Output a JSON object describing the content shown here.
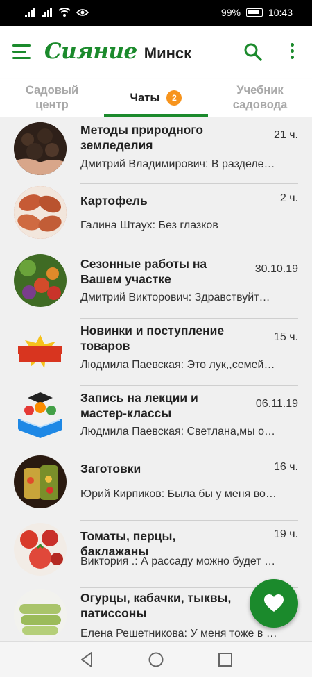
{
  "status_bar": {
    "battery": "99%",
    "time": "10:43"
  },
  "app_bar": {
    "brand": "Сияние",
    "city": "Минск"
  },
  "tabs": [
    {
      "label": "Садовый центр",
      "active": false
    },
    {
      "label": "Чаты",
      "active": true,
      "badge": "2"
    },
    {
      "label": "Учебник садовода",
      "active": false
    }
  ],
  "chats": [
    {
      "title": "Методы природного земледелия",
      "time": "21 ч.",
      "preview": "Дмитрий Владимирович: В разделе…",
      "avatar_icon": "soil-icon"
    },
    {
      "title": "Картофель",
      "time": "2 ч.",
      "preview": "Галина Штаух: Без глазков",
      "avatar_icon": "potato-icon"
    },
    {
      "title": "Сезонные работы на Вашем участке",
      "time": "30.10.19",
      "preview": "Дмитрий  Викторович: Здравствуйт…",
      "avatar_icon": "vegetables-icon"
    },
    {
      "title": "Новинки и поступление товаров",
      "time": "15 ч.",
      "preview": "Людмила Паевская: Это лук,,семей…",
      "avatar_icon": "new-items-icon"
    },
    {
      "title": "Запись на лекции и мастер-классы",
      "time": "06.11.19",
      "preview": "Людмила Паевская: Светлана,мы о…",
      "avatar_icon": "education-icon"
    },
    {
      "title": "Заготовки",
      "time": "16 ч.",
      "preview": "Юрий Кирпиков: Была бы у меня во…",
      "avatar_icon": "preserves-icon"
    },
    {
      "title": "Томаты, перцы, баклажаны",
      "time": "19 ч.",
      "preview": "Виктория .: А рассаду можно будет …",
      "avatar_icon": "tomato-icon"
    },
    {
      "title": "Огурцы, кабачки, тыквы, патиссоны",
      "time": "",
      "preview": "Елена Решетникова: У меня тоже в …",
      "avatar_icon": "zucchini-icon"
    }
  ],
  "colors": {
    "brand_green": "#1b8a2c",
    "badge_orange": "#f7941d"
  },
  "fab": {
    "icon": "heart-icon"
  }
}
